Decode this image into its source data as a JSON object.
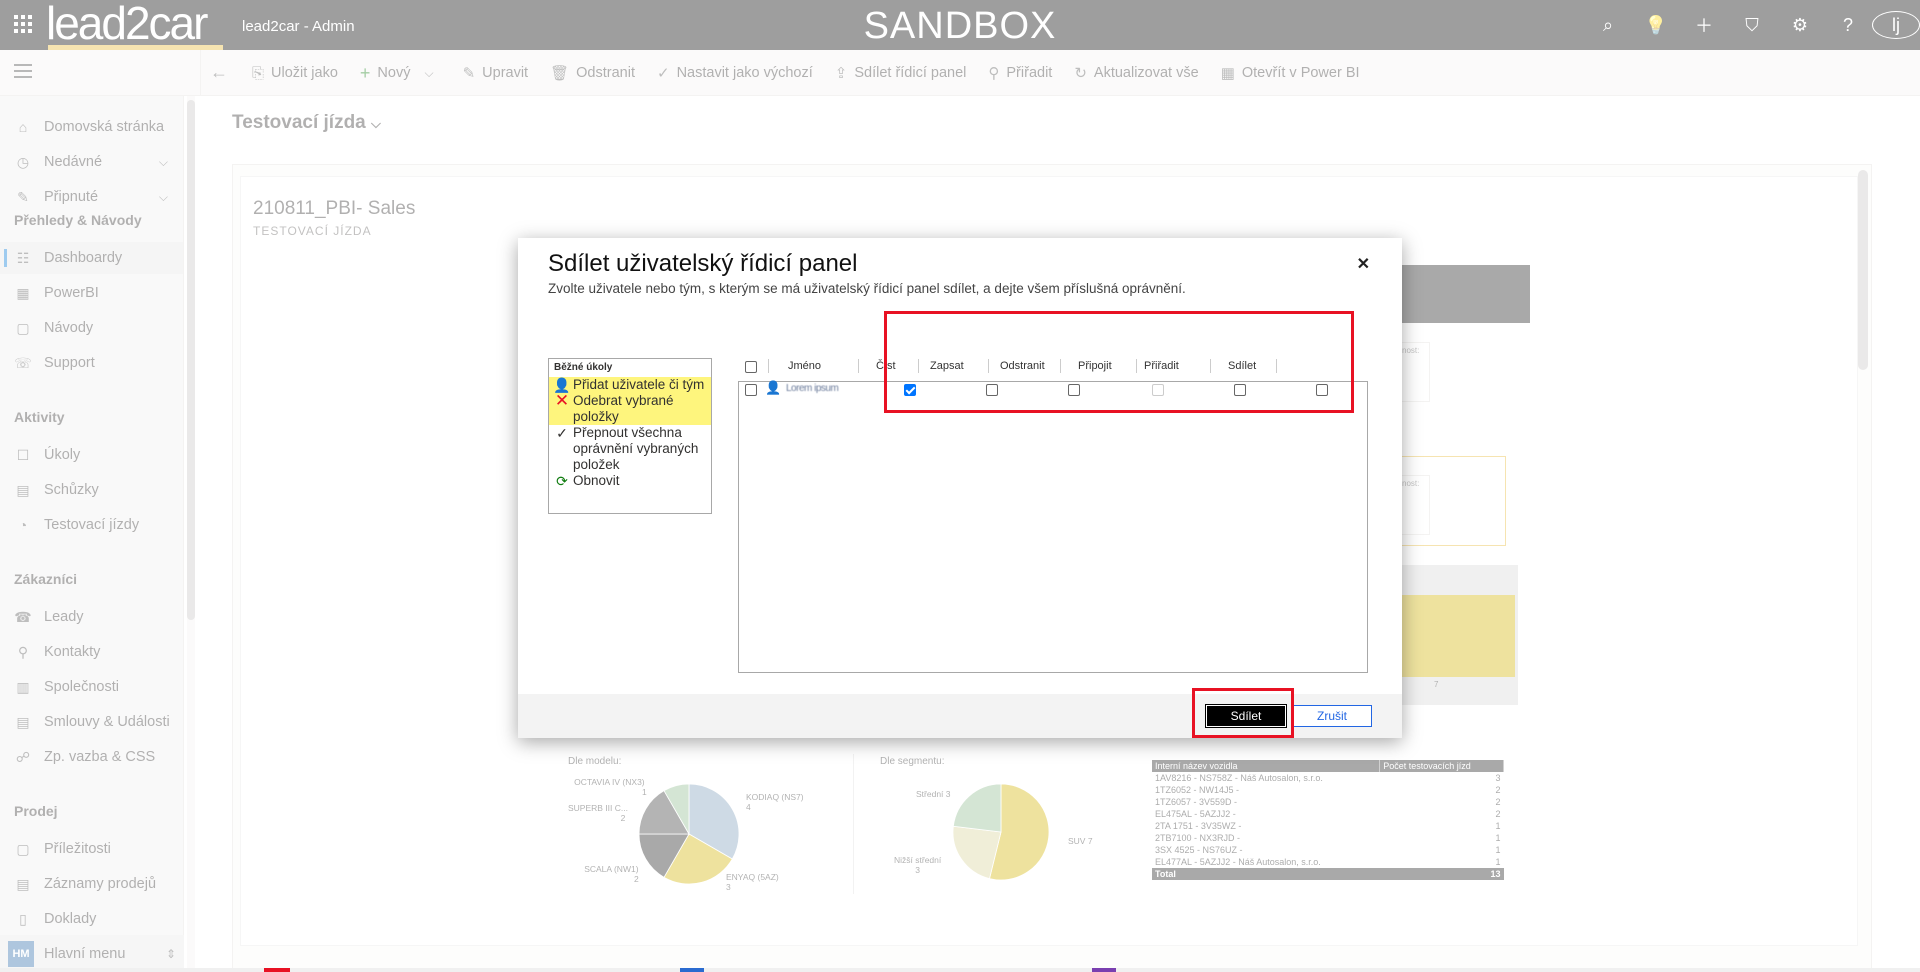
{
  "topbar": {
    "logo": "lead2car",
    "app_title": "lead2car - Admin",
    "environment": "SANDBOX",
    "user_initials": "lj",
    "icons": [
      "search-icon",
      "lightbulb-icon",
      "plus-icon",
      "filter-icon",
      "gear-icon",
      "help-icon"
    ]
  },
  "commands": [
    {
      "icon": "⎘",
      "label": "Uložit jako"
    },
    {
      "icon": "+",
      "label": "Nový"
    },
    {
      "icon": "✎",
      "label": "Upravit"
    },
    {
      "icon": "🗑",
      "label": "Odstranit"
    },
    {
      "icon": "✓",
      "label": "Nastavit jako výchozí"
    },
    {
      "icon": "⇪",
      "label": "Sdílet řídicí panel"
    },
    {
      "icon": "⚲",
      "label": "Přiřadit"
    },
    {
      "icon": "↻",
      "label": "Aktualizovat vše"
    },
    {
      "icon": "▦",
      "label": "Otevřít v Power BI"
    }
  ],
  "sidebar": {
    "home": "Domovská stránka",
    "recent": "Nedávné",
    "pinned": "Připnuté",
    "group1": "Přehledy & Návody",
    "g1_items": [
      "Dashboardy",
      "PowerBI",
      "Návody",
      "Support"
    ],
    "group2": "Aktivity",
    "g2_items": [
      "Úkoly",
      "Schůzky",
      "Testovací jízdy"
    ],
    "group3": "Zákazníci",
    "g3_items": [
      "Leady",
      "Kontakty",
      "Společnosti",
      "Smlouvy & Události",
      "Zp. vazba & CSS"
    ],
    "group4": "Prodej",
    "g4_items": [
      "Příležitosti",
      "Záznamy prodejů",
      "Doklady"
    ],
    "footer_badge": "HM",
    "footer_label": "Hlavní menu"
  },
  "page": {
    "title": "Testovací jízda",
    "report_title": "210811_PBI- Sales",
    "report_subtitle": "TESTOVACÍ JÍZDA",
    "kpi_label": "nost:"
  },
  "charts": {
    "model_label": "Dle modelu:",
    "segment_label": "Dle segmentu:",
    "model_labels": [
      "OCTAVIA IV (NX3)",
      "1",
      "KODIAQ (NS7)",
      "4",
      "SUPERB III C...",
      "2",
      "SCALA (NW1)",
      "2",
      "ENYAQ (5AZ)",
      "3"
    ],
    "segment_labels": [
      "Střední 3",
      "SUV 7",
      "Nižší střední",
      "3"
    ],
    "bar_label": "7"
  },
  "chart_data": [
    {
      "type": "pie",
      "title": "Dle modelu:",
      "categories": [
        "KODIAQ (NS7)",
        "ENYAQ (5AZ)",
        "SCALA (NW1)",
        "SUPERB III C...",
        "OCTAVIA IV (NX3)"
      ],
      "values": [
        4,
        3,
        2,
        2,
        1
      ],
      "colors": [
        "#7f9fba",
        "#d2b400",
        "#1e1e1e",
        "#3a3a3a",
        "#8fbc8f"
      ]
    },
    {
      "type": "pie",
      "title": "Dle segmentu:",
      "categories": [
        "SUV",
        "Nižší střední",
        "Střední"
      ],
      "values": [
        7,
        3,
        3
      ],
      "colors": [
        "#d2b400",
        "#d8d29a",
        "#8fbc8f"
      ]
    }
  ],
  "vehicle_table": {
    "headers": [
      "Interní název vozidla",
      "Počet testovacích jízd"
    ],
    "rows": [
      [
        "1AV8216 - NS758Z - Náš Autosalon, s.r.o.",
        "3"
      ],
      [
        "1TZ6052 - NW14J5 -",
        "2"
      ],
      [
        "1TZ6057 - 3V559D -",
        "2"
      ],
      [
        "EL475AL - 5AZJJ2 -",
        "2"
      ],
      [
        "2TA 1751 - 3V35WZ -",
        "1"
      ],
      [
        "2TB7100 - NX3RJD -",
        "1"
      ],
      [
        "3SX 4525 - NS76UZ -",
        "1"
      ],
      [
        "EL477AL - 5AZJJ2 - Náš Autosalon, s.r.o.",
        "1"
      ]
    ],
    "total_label": "Total",
    "total_value": "13"
  },
  "dialog": {
    "title": "Sdílet uživatelský řídicí panel",
    "subtitle": "Zvolte uživatele nebo tým, s kterým se má uživatelský řídicí panel sdílet, a dejte všem příslušná oprávnění.",
    "tasks_header": "Běžné úkoly",
    "tasks": [
      {
        "label": "Přidat uživatele či tým",
        "icon": "👤",
        "highlight": true
      },
      {
        "label": "Odebrat vybrané položky",
        "icon": "✕",
        "highlight": true
      },
      {
        "label": "Přepnout všechna oprávnění vybraných položek",
        "icon": "✓",
        "highlight": false
      },
      {
        "label": "Obnovit",
        "icon": "⟳",
        "highlight": false
      }
    ],
    "columns": [
      "Jméno",
      "Číst",
      "Zapsat",
      "Odstranit",
      "Připojit",
      "Přiřadit",
      "Sdílet"
    ],
    "row": {
      "name": "Lorem ipsum",
      "read": true,
      "write": false,
      "delete": false,
      "append": false,
      "assign": false,
      "share": false
    },
    "share_button": "Sdílet",
    "cancel_button": "Zrušit"
  },
  "colors": {
    "accent": "#0078d4",
    "highlight": "#fef57d",
    "annotation": "#e81123",
    "brand_underline": "#e8b832"
  }
}
